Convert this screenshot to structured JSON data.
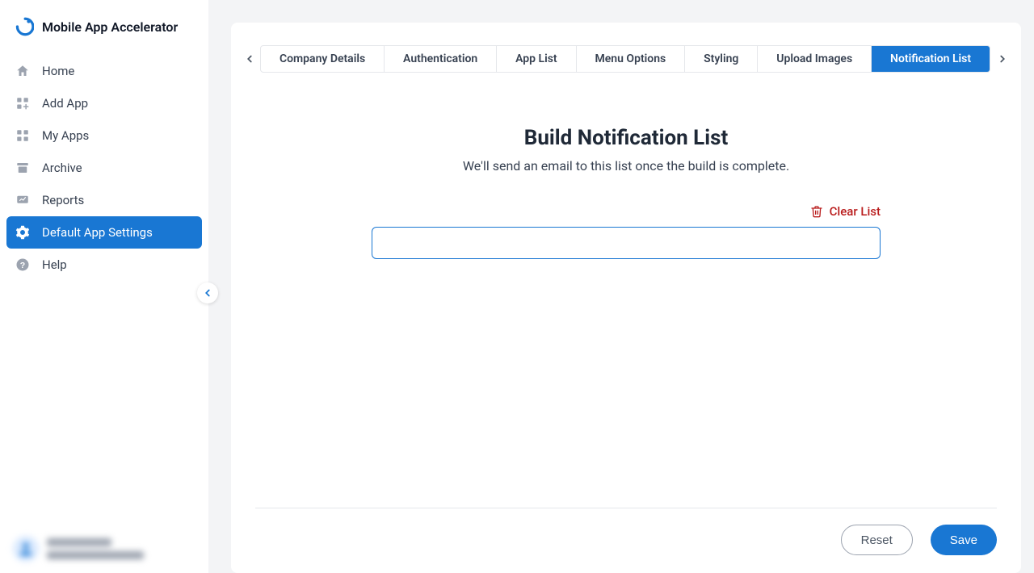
{
  "brand": {
    "title": "Mobile App Accelerator"
  },
  "sidebar": {
    "items": [
      {
        "label": "Home"
      },
      {
        "label": "Add App"
      },
      {
        "label": "My Apps"
      },
      {
        "label": "Archive"
      },
      {
        "label": "Reports"
      },
      {
        "label": "Default App Settings"
      },
      {
        "label": "Help"
      }
    ]
  },
  "tabs": [
    {
      "label": "Company Details"
    },
    {
      "label": "Authentication"
    },
    {
      "label": "App List"
    },
    {
      "label": "Menu Options"
    },
    {
      "label": "Styling"
    },
    {
      "label": "Upload Images"
    },
    {
      "label": "Notification List"
    }
  ],
  "page": {
    "title": "Build Notification List",
    "subtitle": "We'll send an email to this list once the build is complete.",
    "clear_label": "Clear List",
    "input_value": ""
  },
  "footer": {
    "reset_label": "Reset",
    "save_label": "Save"
  }
}
